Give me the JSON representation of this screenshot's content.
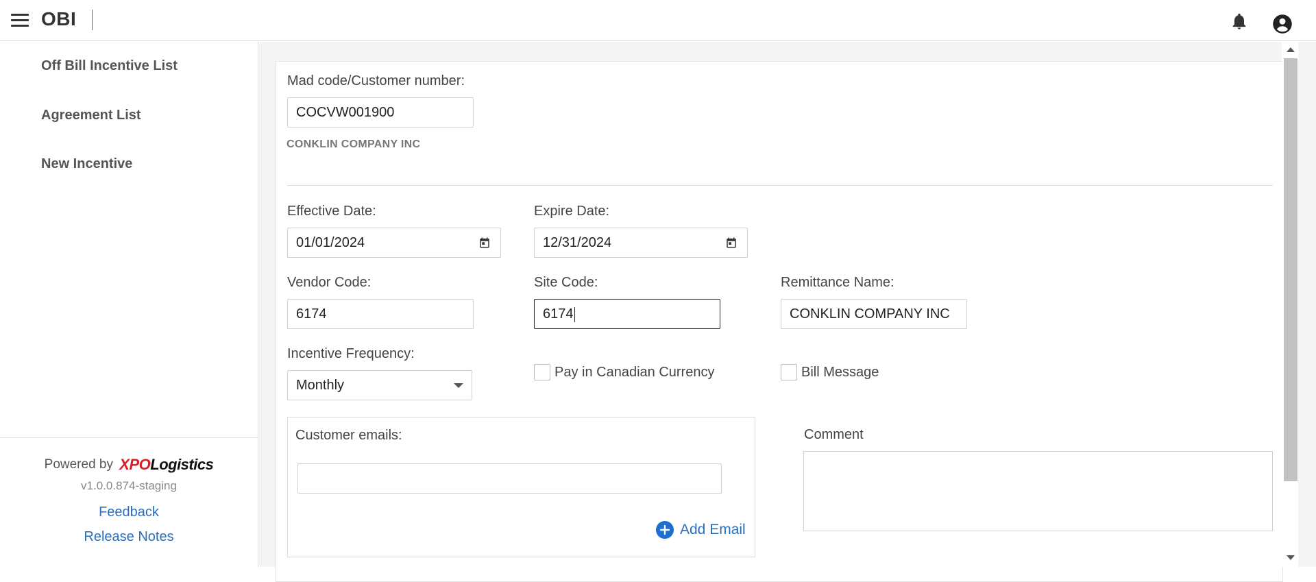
{
  "header": {
    "app_title": "OBI",
    "icons": [
      "menu-icon",
      "bell-icon",
      "account-circle-icon"
    ]
  },
  "sidebar": {
    "items": [
      {
        "label": "Off Bill Incentive List"
      },
      {
        "label": "Agreement List"
      },
      {
        "label": "New Incentive"
      }
    ],
    "footer": {
      "powered_by": "Powered by",
      "brand_xpo": "XPO",
      "brand_logistics": "Logistics",
      "version": "v1.0.0.874-staging",
      "feedback_label": "Feedback",
      "release_notes_label": "Release Notes"
    }
  },
  "form": {
    "mad_code_label": "Mad code/Customer number:",
    "mad_code_value": "COCVW001900",
    "customer_name": "CONKLIN COMPANY INC",
    "effective_date_label": "Effective Date:",
    "effective_date_value": "01/01/2024",
    "expire_date_label": "Expire Date:",
    "expire_date_value": "12/31/2024",
    "vendor_code_label": "Vendor Code:",
    "vendor_code_value": "6174",
    "site_code_label": "Site Code:",
    "site_code_value": "6174",
    "remittance_name_label": "Remittance Name:",
    "remittance_name_value": "CONKLIN COMPANY INC",
    "incentive_frequency_label": "Incentive Frequency:",
    "incentive_frequency_value": "Monthly",
    "pay_canadian_label": "Pay in Canadian Currency",
    "pay_canadian_checked": false,
    "bill_message_label": "Bill Message",
    "bill_message_checked": false,
    "customer_emails_label": "Customer emails:",
    "customer_email_value": "",
    "add_email_label": "Add Email",
    "comment_label": "Comment",
    "comment_value": ""
  },
  "colors": {
    "link": "#2a6ebb",
    "add_icon": "#1f6fd1",
    "brand_red": "#d61f26"
  }
}
